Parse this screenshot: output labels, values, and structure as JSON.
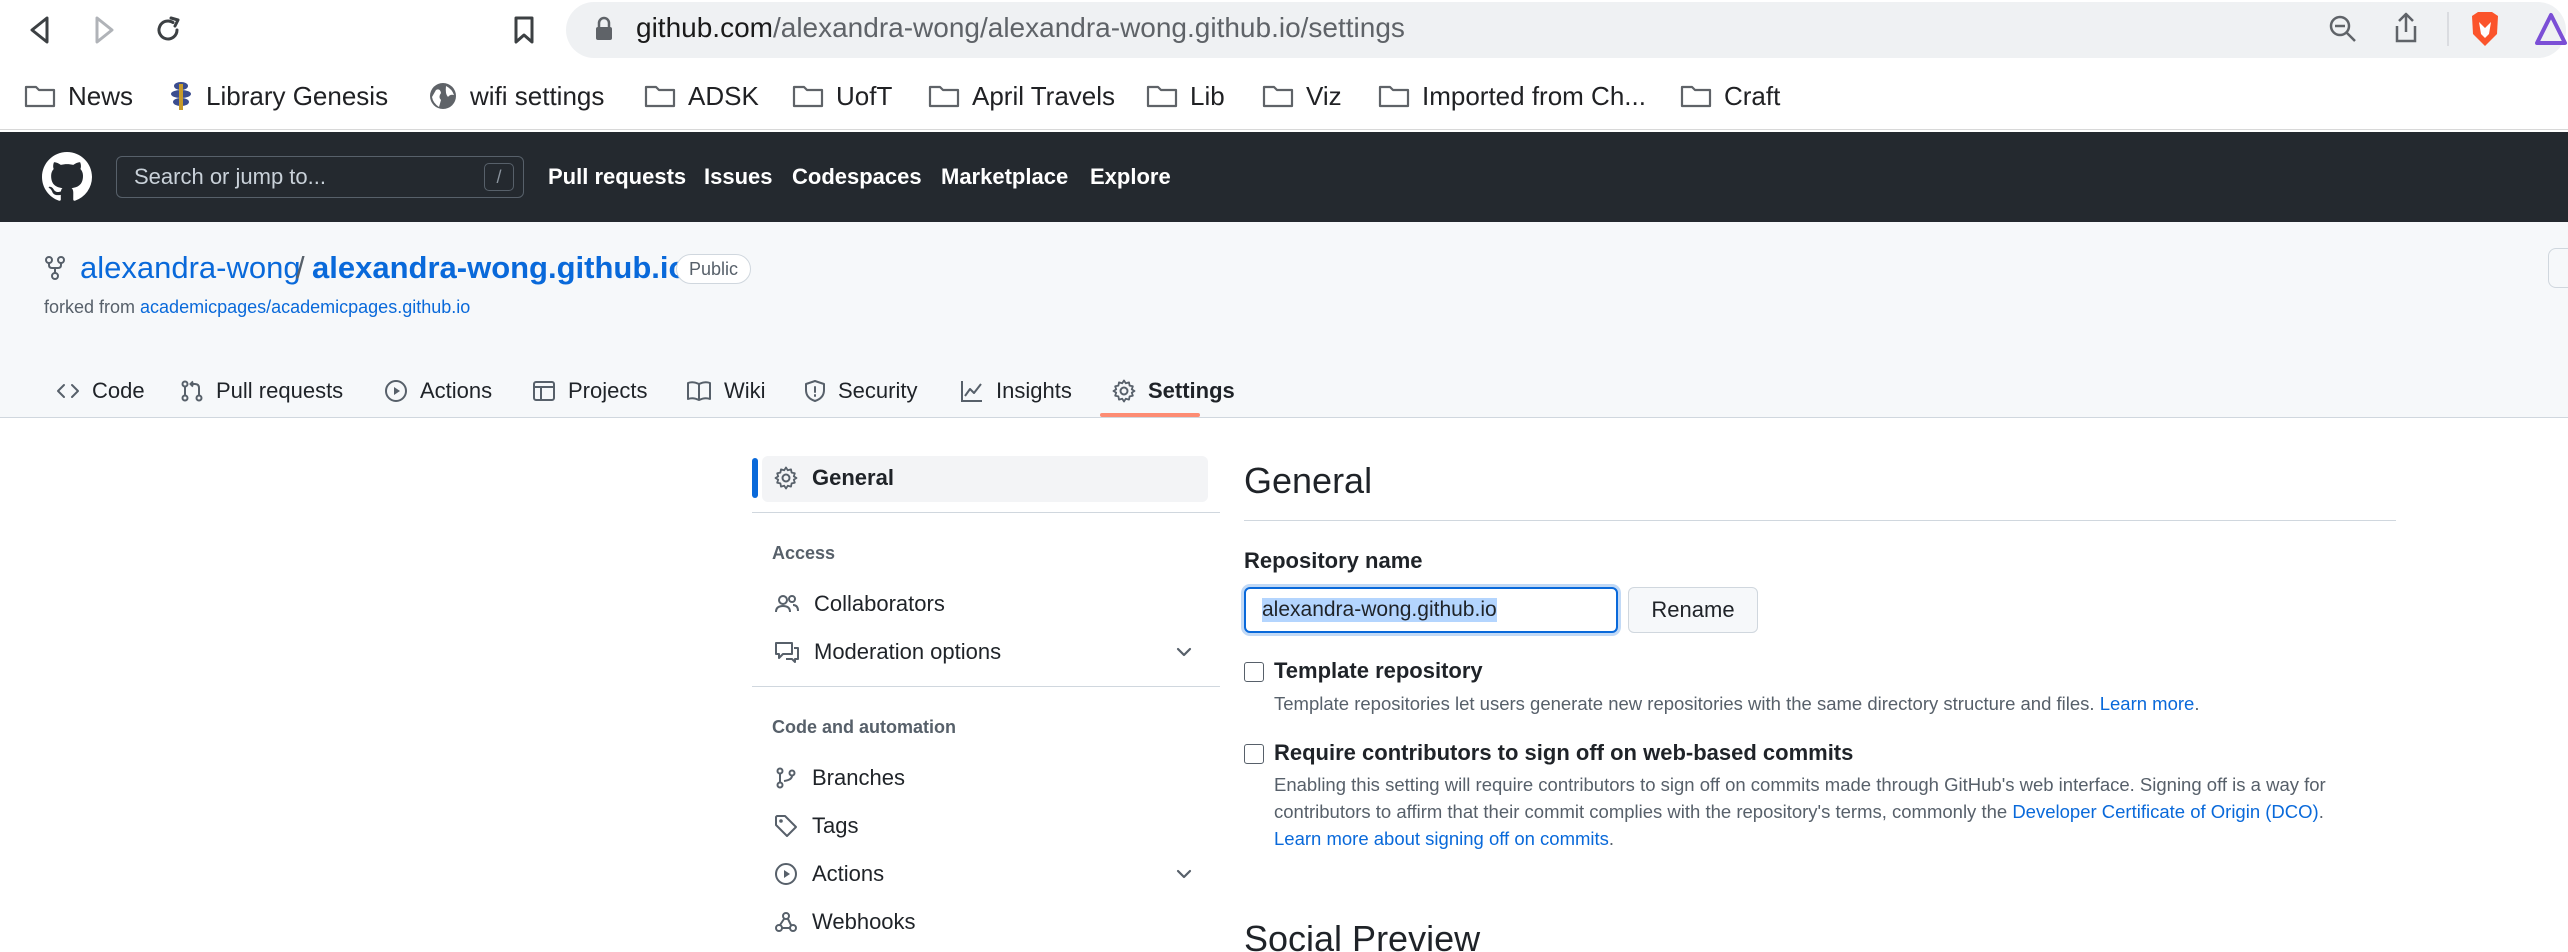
{
  "browser": {
    "url_host": "github.com",
    "url_path": "/alexandra-wong/alexandra-wong.github.io/settings",
    "bookmarks": [
      {
        "label": "News",
        "icon": "folder-icon"
      },
      {
        "label": "Library Genesis",
        "icon": "library-genesis-icon"
      },
      {
        "label": "wifi settings",
        "icon": "globe-icon"
      },
      {
        "label": "ADSK",
        "icon": "folder-icon"
      },
      {
        "label": "UofT",
        "icon": "folder-icon"
      },
      {
        "label": "April Travels",
        "icon": "folder-icon"
      },
      {
        "label": "Lib",
        "icon": "folder-icon"
      },
      {
        "label": "Viz",
        "icon": "folder-icon"
      },
      {
        "label": "Imported from Ch...",
        "icon": "folder-icon"
      },
      {
        "label": "Craft",
        "icon": "folder-icon"
      }
    ]
  },
  "github_header": {
    "search_placeholder": "Search or jump to...",
    "search_shortcut": "/",
    "nav": [
      "Pull requests",
      "Issues",
      "Codespaces",
      "Marketplace",
      "Explore"
    ]
  },
  "repo": {
    "owner": "alexandra-wong",
    "separator": "/",
    "name": "alexandra-wong.github.io",
    "visibility": "Public",
    "forked_prefix": "forked from ",
    "forked_from": "academicpages/academicpages.github.io"
  },
  "repo_tabs": [
    {
      "label": "Code",
      "icon": "code-icon"
    },
    {
      "label": "Pull requests",
      "icon": "pull-request-icon"
    },
    {
      "label": "Actions",
      "icon": "play-icon"
    },
    {
      "label": "Projects",
      "icon": "table-icon"
    },
    {
      "label": "Wiki",
      "icon": "book-icon"
    },
    {
      "label": "Security",
      "icon": "shield-icon"
    },
    {
      "label": "Insights",
      "icon": "graph-icon"
    },
    {
      "label": "Settings",
      "icon": "gear-icon",
      "active": true
    }
  ],
  "sidebar": {
    "general": "General",
    "access_heading": "Access",
    "access_items": [
      "Collaborators",
      "Moderation options"
    ],
    "code_heading": "Code and automation",
    "code_items": [
      "Branches",
      "Tags",
      "Actions",
      "Webhooks"
    ]
  },
  "main": {
    "title": "General",
    "repo_name_label": "Repository name",
    "repo_name_value": "alexandra-wong.github.io",
    "rename_button": "Rename",
    "template": {
      "label": "Template repository",
      "note": "Template repositories let users generate new repositories with the same directory structure and files. ",
      "link": "Learn more",
      "period": "."
    },
    "signoff": {
      "label": "Require contributors to sign off on web-based commits",
      "note_line1": "Enabling this setting will require contributors to sign off on commits made through GitHub's web interface. Signing off is a way for",
      "note_line2": "contributors to affirm that their commit complies with the repository's terms, commonly the ",
      "dco_link": "Developer Certificate of Origin (DCO)",
      "period": ".",
      "learn_link": "Learn more about signing off on commits",
      "period2": "."
    },
    "social_preview_title": "Social Preview"
  }
}
